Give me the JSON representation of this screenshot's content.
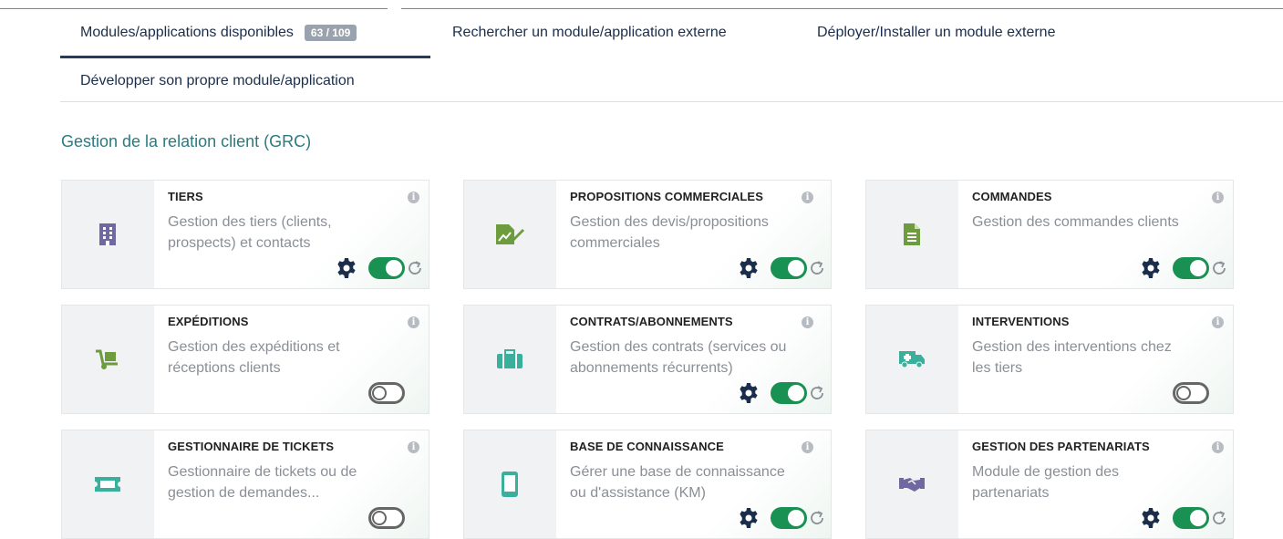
{
  "tabs": [
    {
      "label": "Modules/applications disponibles",
      "badge": "63 / 109",
      "active": true
    },
    {
      "label": "Rechercher un module/application externe",
      "active": false
    },
    {
      "label": "Déployer/Installer un module externe",
      "active": false
    },
    {
      "label": "Développer son propre module/application",
      "active": false
    }
  ],
  "section": {
    "title": "Gestion de la relation client (GRC)"
  },
  "colors": {
    "enabled": "#199152",
    "accent": "#263c5c",
    "section": "#2a7b80",
    "icon_purple": "#6e6aa0",
    "icon_green": "#6c9c3e",
    "icon_teal": "#3ab09c"
  },
  "modules": [
    {
      "name": "TIERS",
      "description": "Gestion des tiers (clients, prospects) et contacts",
      "icon": "building-icon",
      "enabled": true,
      "has_settings": true
    },
    {
      "name": "PROPOSITIONS COMMERCIALES",
      "description": "Gestion des devis/propositions commerciales",
      "icon": "signed-document-icon",
      "enabled": true,
      "has_settings": true
    },
    {
      "name": "COMMANDES",
      "description": "Gestion des commandes clients",
      "icon": "order-document-icon",
      "enabled": true,
      "has_settings": true
    },
    {
      "name": "EXPÉDITIONS",
      "description": "Gestion des expéditions et réceptions clients",
      "icon": "dolly-icon",
      "enabled": false,
      "has_settings": false
    },
    {
      "name": "CONTRATS/ABONNEMENTS",
      "description": "Gestion des contrats (services ou abonnements récurrents)",
      "icon": "suitcase-icon",
      "enabled": true,
      "has_settings": true
    },
    {
      "name": "INTERVENTIONS",
      "description": "Gestion des interventions chez les tiers",
      "icon": "ambulance-icon",
      "enabled": false,
      "has_settings": false
    },
    {
      "name": "GESTIONNAIRE DE TICKETS",
      "description": "Gestionnaire de tickets ou de gestion de demandes...",
      "icon": "ticket-icon",
      "enabled": false,
      "has_settings": false
    },
    {
      "name": "BASE DE CONNAISSANCE",
      "description": "Gérer une base de connaissance ou d'assistance (KM)",
      "icon": "mobile-icon",
      "enabled": true,
      "has_settings": true
    },
    {
      "name": "GESTION DES PARTENARIATS",
      "description": "Module de gestion des partenariats",
      "icon": "handshake-icon",
      "enabled": true,
      "has_settings": true
    }
  ]
}
